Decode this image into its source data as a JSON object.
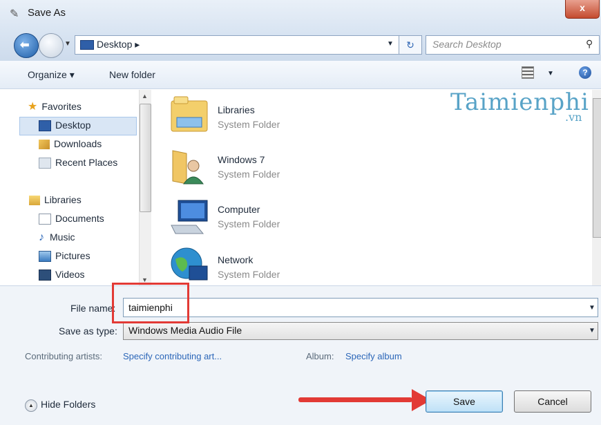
{
  "window": {
    "title": "Save As",
    "close_glyph": "x"
  },
  "address": {
    "path": "Desktop ▸",
    "refresh_glyph": "↻"
  },
  "search": {
    "placeholder": "Search Desktop"
  },
  "toolbar": {
    "organize": "Organize ▾",
    "new_folder": "New folder",
    "help": "?"
  },
  "nav": {
    "favorites_header": "Favorites",
    "favorites": [
      "Desktop",
      "Downloads",
      "Recent Places"
    ],
    "libraries_header": "Libraries",
    "libraries": [
      "Documents",
      "Music",
      "Pictures",
      "Videos"
    ]
  },
  "files": [
    {
      "name": "Libraries",
      "type": "System Folder",
      "icon": "libraries-icon"
    },
    {
      "name": "Windows 7",
      "type": "System Folder",
      "icon": "user-folder-icon"
    },
    {
      "name": "Computer",
      "type": "System Folder",
      "icon": "computer-icon"
    },
    {
      "name": "Network",
      "type": "System Folder",
      "icon": "network-icon"
    }
  ],
  "watermark": {
    "text": "Taimienphi",
    "suffix": ".vn"
  },
  "form": {
    "file_name_label": "File name:",
    "file_name_value": "taimienphi",
    "save_as_type_label": "Save as type:",
    "save_as_type_value": "Windows Media Audio File",
    "artists_label": "Contributing artists:",
    "artists_value": "Specify contributing art...",
    "album_label": "Album:",
    "album_value": "Specify album"
  },
  "footer": {
    "hide_folders": "Hide Folders",
    "save": "Save",
    "cancel": "Cancel"
  },
  "colors": {
    "accent": "#2b66b8",
    "highlight": "#e23a35"
  }
}
